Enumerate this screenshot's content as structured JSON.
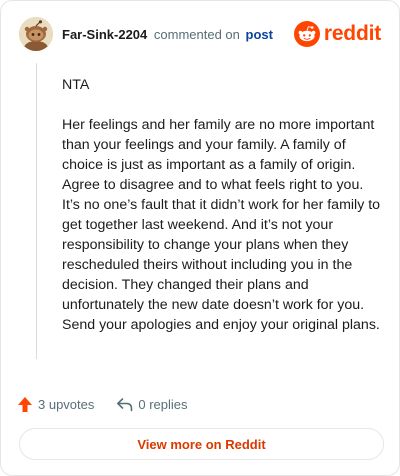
{
  "header": {
    "author": "Far-Sink-2204",
    "commented_text": "commented on",
    "post_link": "post",
    "brand_name": "reddit",
    "brand_color": "#ff4500",
    "avatar_icon": "snoo-avatar-icon"
  },
  "comment": {
    "paragraphs": [
      "NTA",
      "Her feelings and her family are no more important than your feelings and your family. A family of choice is just as important as a family of origin. Agree to disagree and to what feels right to you. It’s no one’s fault that it didn’t work for her family to get together last weekend. And it’s not your responsibility to change your plans when they rescheduled theirs without including you in the decision. They changed their plans and unfortunately the new date doesn’t work for you. Send your apologies and enjoy your original plans."
    ]
  },
  "actions": {
    "upvotes_label": "3 upvotes",
    "replies_label": "0 replies",
    "upvote_icon": "upvote-arrow-icon",
    "reply_icon": "reply-arrow-icon",
    "upvote_color": "#ff4500"
  },
  "footer": {
    "view_more_label": "View more on Reddit"
  }
}
